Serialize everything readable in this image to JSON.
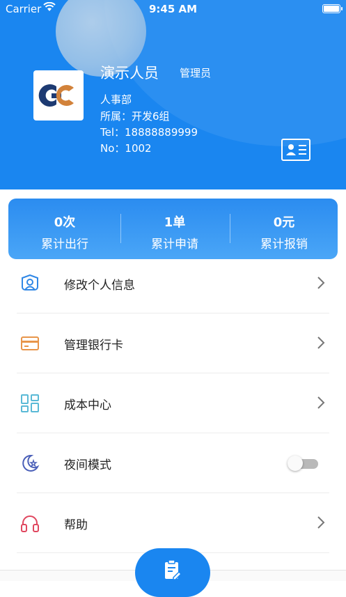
{
  "status_bar": {
    "carrier": "Carrier",
    "time": "9:45 AM"
  },
  "profile": {
    "name": "演示人员",
    "role": "管理员",
    "department": "人事部",
    "group": "所属：开发6组",
    "phone": "Tel：18888889999",
    "number": "No：1002"
  },
  "stats": [
    {
      "value": "0次",
      "label": "累计出行"
    },
    {
      "value": "1单",
      "label": "累计申请"
    },
    {
      "value": "0元",
      "label": "累计报销"
    }
  ],
  "menu": [
    {
      "label": "修改个人信息",
      "icon": "user-profile-icon"
    },
    {
      "label": "管理银行卡",
      "icon": "bank-card-icon"
    },
    {
      "label": "成本中心",
      "icon": "grid-layout-icon"
    },
    {
      "label": "夜间模式",
      "icon": "moon-star-icon",
      "toggle": false
    },
    {
      "label": "帮助",
      "icon": "headphones-icon"
    }
  ],
  "colors": {
    "primary": "#1a86f0",
    "stats_gradient_end": "#4aa6f7",
    "logo_blue": "#1d3a72",
    "logo_orange": "#d2823a"
  }
}
